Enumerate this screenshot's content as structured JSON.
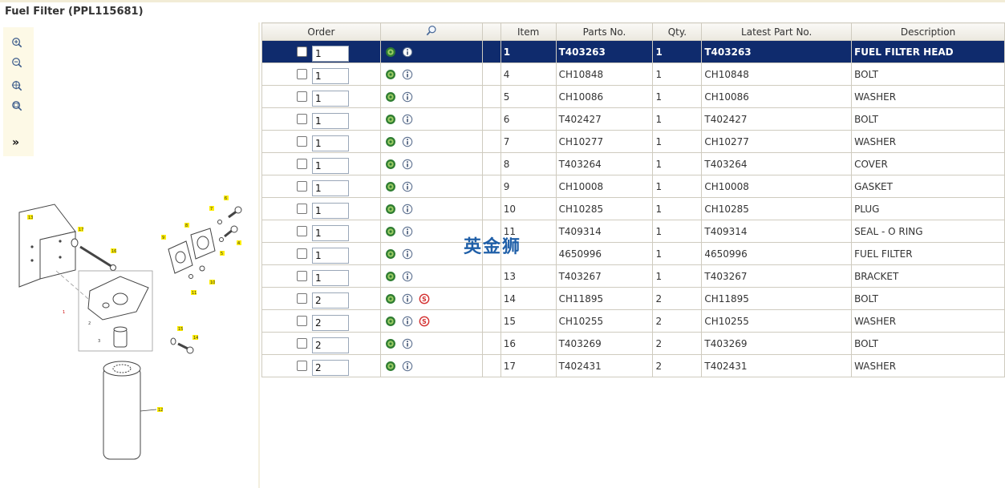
{
  "page": {
    "title": "Fuel Filter (PPL115681)"
  },
  "toolbar": {
    "expand_label": "»",
    "icons": [
      "zoom-in-icon",
      "zoom-out-icon",
      "zoom-fit-icon",
      "zoom-window-icon"
    ]
  },
  "diagram": {
    "callouts": [
      "13",
      "17",
      "16",
      "9",
      "8",
      "7",
      "6",
      "4",
      "5",
      "11",
      "10",
      "1",
      "2",
      "3",
      "15",
      "14",
      "12"
    ]
  },
  "table": {
    "headers": {
      "order": "Order",
      "item": "Item",
      "parts_no": "Parts No.",
      "qty": "Qty.",
      "latest_part_no": "Latest Part No.",
      "description": "Description"
    },
    "rows": [
      {
        "order_qty": "1",
        "item": "1",
        "parts_no": "T403263",
        "qty": "1",
        "latest": "T403263",
        "description": "FUEL FILTER HEAD",
        "s_badge": false,
        "selected": true
      },
      {
        "order_qty": "1",
        "item": "4",
        "parts_no": "CH10848",
        "qty": "1",
        "latest": "CH10848",
        "description": "BOLT",
        "s_badge": false,
        "selected": false
      },
      {
        "order_qty": "1",
        "item": "5",
        "parts_no": "CH10086",
        "qty": "1",
        "latest": "CH10086",
        "description": "WASHER",
        "s_badge": false,
        "selected": false
      },
      {
        "order_qty": "1",
        "item": "6",
        "parts_no": "T402427",
        "qty": "1",
        "latest": "T402427",
        "description": "BOLT",
        "s_badge": false,
        "selected": false
      },
      {
        "order_qty": "1",
        "item": "7",
        "parts_no": "CH10277",
        "qty": "1",
        "latest": "CH10277",
        "description": "WASHER",
        "s_badge": false,
        "selected": false
      },
      {
        "order_qty": "1",
        "item": "8",
        "parts_no": "T403264",
        "qty": "1",
        "latest": "T403264",
        "description": "COVER",
        "s_badge": false,
        "selected": false
      },
      {
        "order_qty": "1",
        "item": "9",
        "parts_no": "CH10008",
        "qty": "1",
        "latest": "CH10008",
        "description": "GASKET",
        "s_badge": false,
        "selected": false
      },
      {
        "order_qty": "1",
        "item": "10",
        "parts_no": "CH10285",
        "qty": "1",
        "latest": "CH10285",
        "description": "PLUG",
        "s_badge": false,
        "selected": false
      },
      {
        "order_qty": "1",
        "item": "11",
        "parts_no": "T409314",
        "qty": "1",
        "latest": "T409314",
        "description": "SEAL - O RING",
        "s_badge": false,
        "selected": false
      },
      {
        "order_qty": "1",
        "item": "",
        "parts_no": "4650996",
        "qty": "1",
        "latest": "4650996",
        "description": "FUEL FILTER",
        "s_badge": false,
        "selected": false
      },
      {
        "order_qty": "1",
        "item": "13",
        "parts_no": "T403267",
        "qty": "1",
        "latest": "T403267",
        "description": "BRACKET",
        "s_badge": false,
        "selected": false
      },
      {
        "order_qty": "2",
        "item": "14",
        "parts_no": "CH11895",
        "qty": "2",
        "latest": "CH11895",
        "description": "BOLT",
        "s_badge": true,
        "selected": false
      },
      {
        "order_qty": "2",
        "item": "15",
        "parts_no": "CH10255",
        "qty": "2",
        "latest": "CH10255",
        "description": "WASHER",
        "s_badge": true,
        "selected": false
      },
      {
        "order_qty": "2",
        "item": "16",
        "parts_no": "T403269",
        "qty": "2",
        "latest": "T403269",
        "description": "BOLT",
        "s_badge": false,
        "selected": false
      },
      {
        "order_qty": "2",
        "item": "17",
        "parts_no": "T402431",
        "qty": "2",
        "latest": "T402431",
        "description": "WASHER",
        "s_badge": false,
        "selected": false
      }
    ]
  },
  "watermark": {
    "text": "英金狮",
    "color": "#1f5fa8"
  },
  "colors": {
    "selected_row": "#0f2b6d",
    "gear_icon": "#2e7d32",
    "s_badge": "#d32f2f",
    "toolbar_bg": "#fdf9e6"
  }
}
